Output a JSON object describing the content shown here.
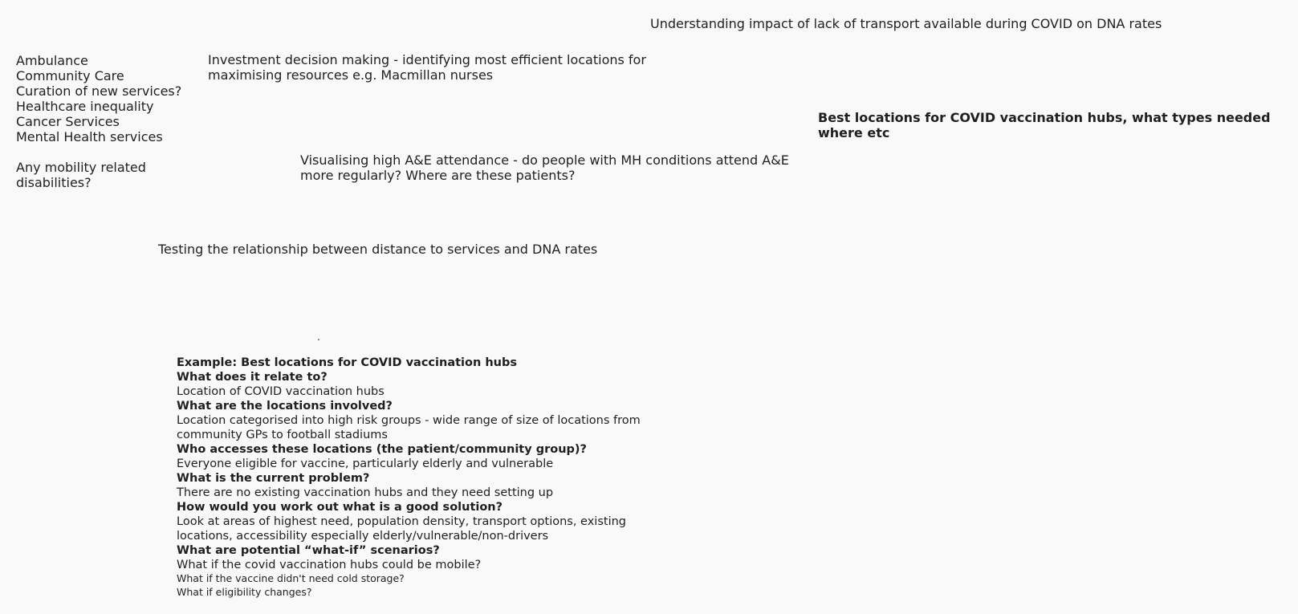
{
  "notes": {
    "transport_covid_dna": "Understanding impact of lack of transport available during COVID on DNA rates",
    "investment": "Investment decision making - identifying most efficient locations for\nmaximising resources e.g. Macmillan nurses",
    "vaccination_hubs": "Best locations for COVID vaccination hubs, what types needed where etc",
    "high_ae": "Visualising high A&E attendance - do people with MH conditions attend A&E\nmore regularly? Where are these patients?",
    "distance_dna": "Testing the relationship between distance to services and DNA rates",
    "dot": "."
  },
  "topics": [
    "Ambulance",
    "Community Care",
    "Curation of new services?",
    "Healthcare inequality",
    "Cancer Services",
    "Mental Health services"
  ],
  "mobility_note": "Any mobility related\ndisabilities?",
  "example": {
    "title": "Example: Best locations for COVID vaccination hubs",
    "q1": "What does it relate to?",
    "a1": "Location of COVID vaccination hubs",
    "q2": "What are the locations involved?",
    "a2": "Location categorised into high risk groups - wide range of size of locations from\ncommunity GPs to football stadiums",
    "q3": "Who accesses these locations (the patient/community group)?",
    "a3": "Everyone eligible for vaccine, particularly elderly and vulnerable",
    "q4": "What is the current problem?",
    "a4": "There are no existing vaccination hubs and they need setting up",
    "q5": "How would you work out what is a good solution?",
    "a5": "Look at areas of highest need, population density, transport options, existing\nlocations, accessibility especially elderly/vulnerable/non-drivers",
    "q6": "What are potential “what-if” scenarios?",
    "a6": "What if the covid vaccination hubs could be mobile?",
    "a7": "What if the vaccine didn't need cold storage?",
    "a8": "What if eligibility changes?"
  }
}
